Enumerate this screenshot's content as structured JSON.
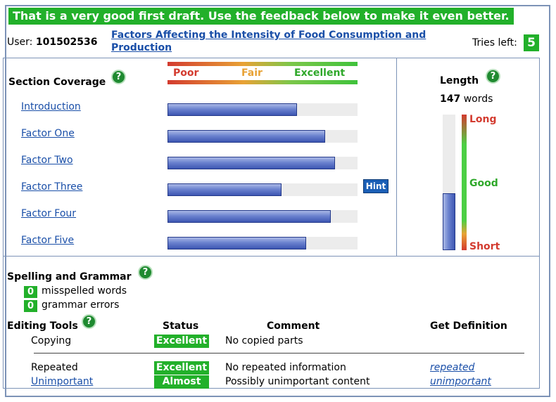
{
  "banner": "That is a very good first draft. Use the feedback below to make it even better.",
  "user": {
    "label": "User:",
    "id": "101502536"
  },
  "assignment_title": "Factors Affecting the Intensity of Food Consumption and Production",
  "tries": {
    "label": "Tries left:",
    "value": "5"
  },
  "section_coverage": {
    "heading": "Section Coverage",
    "scale": {
      "poor": "Poor",
      "fair": "Fair",
      "excellent": "Excellent"
    },
    "sections": [
      {
        "label": "Introduction",
        "fraction": 0.68
      },
      {
        "label": "Factor One",
        "fraction": 0.83
      },
      {
        "label": "Factor Two",
        "fraction": 0.88
      },
      {
        "label": "Factor Three",
        "fraction": 0.6
      },
      {
        "label": "Factor Four",
        "fraction": 0.86
      },
      {
        "label": "Factor Five",
        "fraction": 0.73
      }
    ],
    "hint_label": "Hint"
  },
  "length": {
    "heading": "Length",
    "count": "147",
    "unit": "words",
    "level": 0.42,
    "long": "Long",
    "good": "Good",
    "short": "Short"
  },
  "spelling": {
    "heading": "Spelling and Grammar",
    "misspelled_count": "0",
    "misspelled_label": "misspelled words",
    "grammar_count": "0",
    "grammar_label": "grammar errors"
  },
  "editing": {
    "heading": "Editing Tools",
    "columns": {
      "status": "Status",
      "comment": "Comment",
      "definition": "Get Definition"
    },
    "rows": [
      {
        "tool": "Copying",
        "status": "Excellent",
        "comment": "No copied parts",
        "definition": ""
      },
      {
        "tool": "Repeated",
        "status": "Excellent",
        "comment": "No repeated information",
        "definition": "repeated"
      },
      {
        "tool": "Unimportant",
        "status": "Almost",
        "comment": "Possibly unimportant content",
        "definition": "unimportant"
      }
    ]
  },
  "help_glyph": "?",
  "colors": {
    "accent_green": "#22b02a",
    "link_blue": "#1a4fa8",
    "bar_blue": "#3d56b2"
  }
}
